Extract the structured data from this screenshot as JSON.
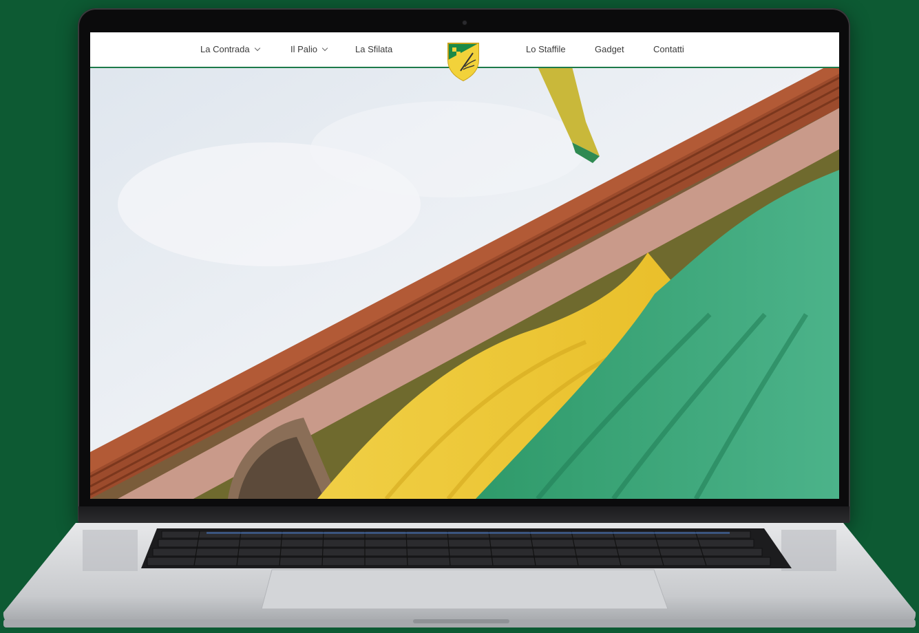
{
  "colors": {
    "background": "#0d5a33",
    "brand_green": "#1c7a49",
    "brand_yellow": "#f2d23a"
  },
  "nav": {
    "items": [
      {
        "label": "La Contrada",
        "has_dropdown": true
      },
      {
        "label": "Il Palio",
        "has_dropdown": true
      },
      {
        "label": "La Sfilata",
        "has_dropdown": false
      },
      {
        "label": "Lo Staffile",
        "has_dropdown": false
      },
      {
        "label": "Gadget",
        "has_dropdown": false
      },
      {
        "label": "Contatti",
        "has_dropdown": false
      }
    ],
    "logo_icon": "contrada-shield-logo-icon"
  },
  "hero": {
    "image": "building-cornice-with-green-and-yellow-drapes"
  }
}
